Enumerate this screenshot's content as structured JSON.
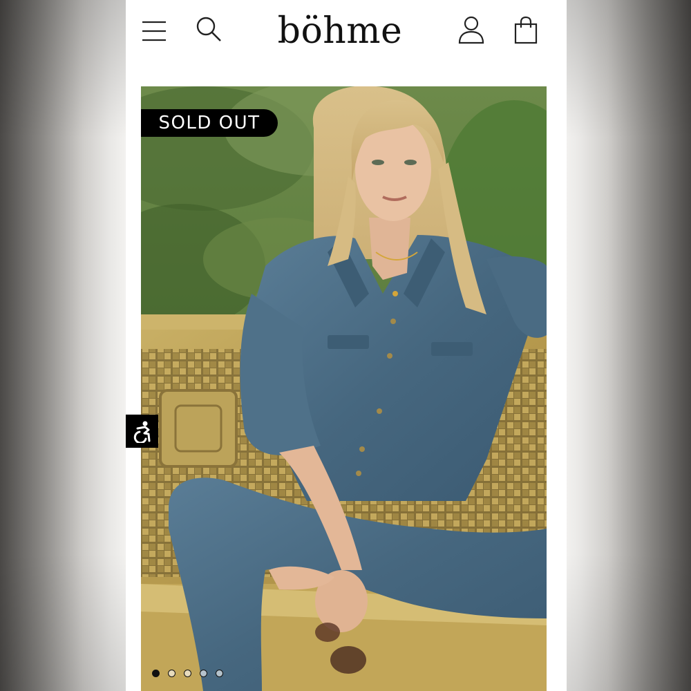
{
  "header": {
    "logo": "böhme",
    "icons": [
      "menu-icon",
      "search-icon",
      "account-icon",
      "shopping-bag-icon"
    ]
  },
  "product": {
    "badge": "SOLD OUT",
    "image_description_icon": "hero-photo"
  },
  "accessibility": {
    "icon": "accessibility-icon"
  },
  "carousel": {
    "total": 5,
    "active_index": 1
  },
  "colors": {
    "text": "#111111",
    "badge_bg": "#000000",
    "badge_text": "#ffffff",
    "background": "#ffffff"
  }
}
